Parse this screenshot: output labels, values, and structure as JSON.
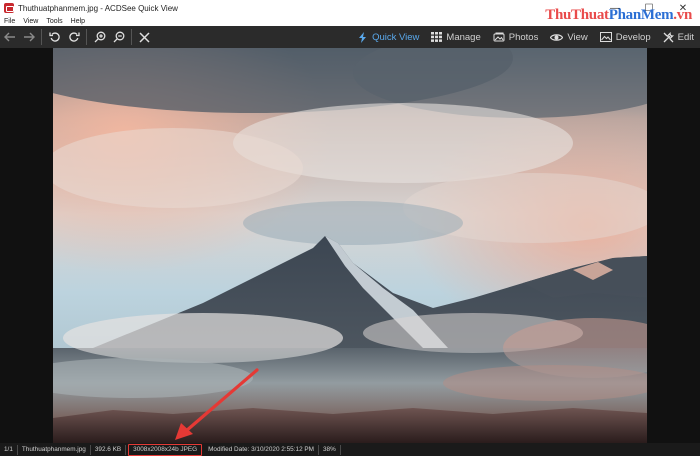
{
  "window": {
    "title": "Thuthuatphanmem.jpg - ACDSee Quick View",
    "minimize_glyph": "—",
    "maximize_glyph": "☐",
    "close_glyph": "✕"
  },
  "menu": [
    "File",
    "View",
    "Tools",
    "Help"
  ],
  "watermark": {
    "part1": "ThuThuat",
    "part2": "PhanMem",
    "part3": ".vn"
  },
  "toolbar": {
    "icons": [
      "back-arrow-icon",
      "forward-arrow-icon",
      "rotate-left-icon",
      "rotate-right-icon",
      "zoom-in-icon",
      "zoom-out-icon",
      "close-x-icon"
    ]
  },
  "modes": [
    {
      "label": "Quick View",
      "icon": "lightning-icon",
      "active": true
    },
    {
      "label": "Manage",
      "icon": "grid-icon",
      "active": false
    },
    {
      "label": "Photos",
      "icon": "photos-icon",
      "active": false
    },
    {
      "label": "View",
      "icon": "eye-icon",
      "active": false
    },
    {
      "label": "Develop",
      "icon": "develop-icon",
      "active": false
    },
    {
      "label": "Edit",
      "icon": "tools-icon",
      "active": false
    }
  ],
  "status": {
    "index": "1/1",
    "filename": "Thuthuatphanmem.jpg",
    "filesize": "392.6 KB",
    "dimensions": "3008x2008x24b JPEG",
    "modified": "Modified Date: 3/10/2020 2:55:12 PM",
    "zoom": "38%"
  },
  "colors": {
    "accent": "#5aa9ec",
    "annotation": "#e53935",
    "toolbar_bg": "#2b2b2b"
  }
}
